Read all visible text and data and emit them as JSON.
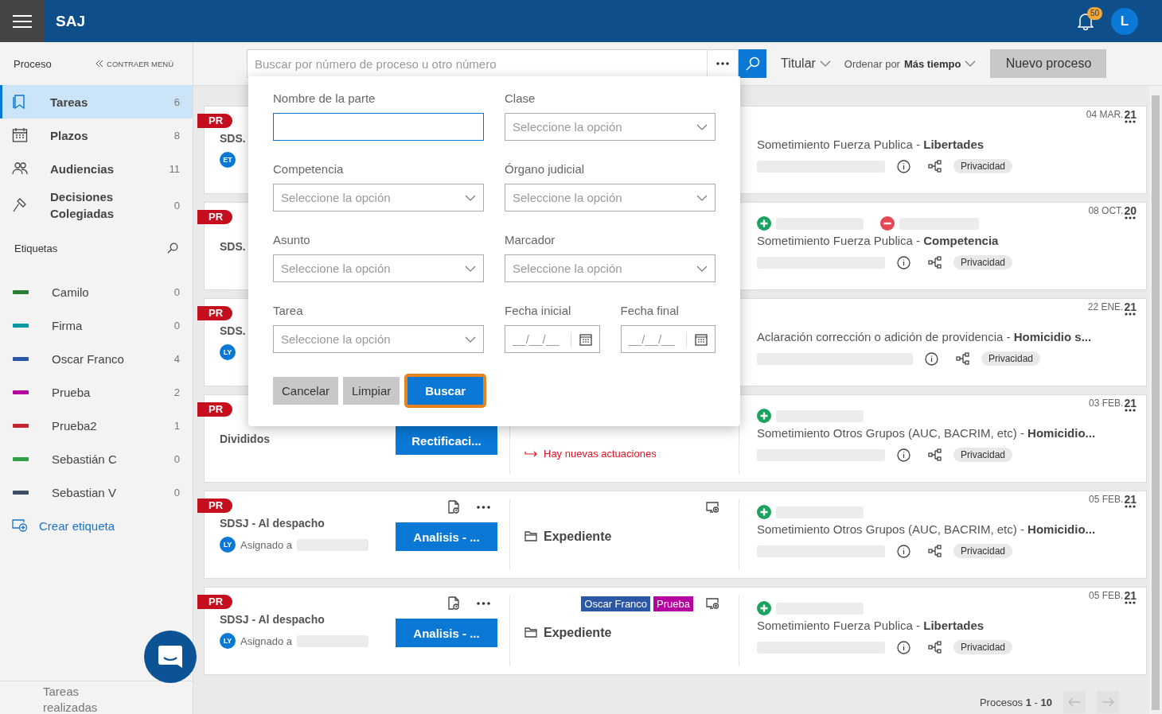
{
  "topbar": {
    "logo": "SAJ",
    "notifications": "50",
    "avatar": "L"
  },
  "sidebar": {
    "title": "Proceso",
    "collapse": "CONTRAER MENÚ",
    "nav": [
      {
        "label": "Tareas",
        "count": "6",
        "selected": true
      },
      {
        "label": "Plazos",
        "count": "8",
        "selected": false
      },
      {
        "label": "Audiencias",
        "count": "11",
        "selected": false
      },
      {
        "label": "Decisiones Colegiadas",
        "count": "0",
        "selected": false
      }
    ],
    "tags_title": "Etiquetas",
    "tags": [
      {
        "label": "Camilo",
        "count": "0",
        "color": "#2e7d32"
      },
      {
        "label": "Firma",
        "count": "0",
        "color": "#0097a7"
      },
      {
        "label": "Oscar Franco",
        "count": "4",
        "color": "#2b57a4"
      },
      {
        "label": "Prueba",
        "count": "2",
        "color": "#b4009e"
      },
      {
        "label": "Prueba2",
        "count": "1",
        "color": "#c4262e"
      },
      {
        "label": "Sebastián C",
        "count": "0",
        "color": "#2ea043"
      },
      {
        "label": "Sebastian V",
        "count": "0",
        "color": "#3b4f63"
      }
    ],
    "create_tag": "Crear etiqueta",
    "footer": "Tareas realizadas"
  },
  "toolbar": {
    "search_placeholder": "Buscar por número de proceso u otro número",
    "owner_filter": "Titular",
    "sort": "Ordenar por **Más tiempo**",
    "new_button": "Nuevo proceso"
  },
  "filter_panel": {
    "fields": [
      {
        "kind": "text",
        "label": "Nombre de la parte",
        "focused": true
      },
      {
        "kind": "select",
        "label": "Clase",
        "placeholder": "Seleccione la opción",
        "focused": false
      },
      {
        "kind": "select",
        "label": "Competencia",
        "placeholder": "Seleccione la opción",
        "focused": false
      },
      {
        "kind": "select",
        "label": "Órgano judicial",
        "placeholder": "Seleccione la opción",
        "focused": false
      },
      {
        "kind": "select",
        "label": "Asunto",
        "placeholder": "Seleccione la opción",
        "focused": false
      },
      {
        "kind": "select",
        "label": "Marcador",
        "placeholder": "Seleccione la opción",
        "focused": false
      },
      {
        "kind": "select",
        "label": "Tarea",
        "placeholder": "Seleccione la opción",
        "focused": false
      },
      {
        "kind": "date",
        "label": "Fecha inicial",
        "placeholder": "__/__/__",
        "focused": false
      },
      {
        "kind": "date",
        "label": "Fecha final",
        "placeholder": "__/__/__",
        "focused": false
      }
    ],
    "buttons": [
      {
        "label": "Cancelar",
        "kind": "secondary",
        "highlighted": false
      },
      {
        "label": "Limpiar",
        "kind": "secondary",
        "highlighted": false
      },
      {
        "label": "Buscar",
        "kind": "primary",
        "highlighted": true
      }
    ]
  },
  "cards": [
    {
      "badge": "PR",
      "title": "SDS.",
      "avatar": "ET",
      "date": "04 MAR.",
      "year": "21",
      "description": "Sometimiento Fuerza Publica - **Libertades**",
      "privacy": "Privacidad"
    },
    {
      "badge": "PR",
      "title": "SDS.",
      "date": "08 OCT.",
      "year": "20",
      "markers": [
        {
          "kind": "added"
        },
        {
          "kind": "removed"
        }
      ],
      "description": "Sometimiento Fuerza Publica - **Competencia**",
      "privacy": "Privacidad"
    },
    {
      "badge": "PR",
      "title": "SDS.",
      "avatar": "LY",
      "date": "22 ENE.",
      "year": "21",
      "description": "Aclaración corrección o adición de providencia - **Homicidio s...**",
      "privacy": "Privacidad"
    },
    {
      "badge": "PR",
      "title": "Divididos",
      "button": "Rectificaci...",
      "alert": "Hay nuevas actuaciones",
      "date": "03 FEB.",
      "year": "21",
      "markers": [
        {
          "kind": "added"
        }
      ],
      "description": "Sometimiento Otros Grupos (AUC, BACRIM, etc) - **Homicidio...**",
      "privacy": "Privacidad"
    },
    {
      "badge": "PR",
      "title": "SDSJ - Al despacho",
      "avatar": "LY",
      "assigned": "Asignado a",
      "button": "Analisis - ...",
      "actions": true,
      "media": true,
      "expediente": "Expediente",
      "date": "05 FEB.",
      "year": "21",
      "markers": [
        {
          "kind": "added"
        }
      ],
      "description": "Sometimiento Otros Grupos (AUC, BACRIM, etc) - **Homicidio...**",
      "privacy": "Privacidad"
    },
    {
      "badge": "PR",
      "title": "SDSJ - Al despacho",
      "avatar": "LY",
      "assigned": "Asignado a",
      "button": "Analisis - ...",
      "actions": true,
      "media": true,
      "tags": [
        {
          "label": "Oscar Franco",
          "color": "#2b57a4"
        },
        {
          "label": "Prueba",
          "color": "#b4009e"
        }
      ],
      "expediente": "Expediente",
      "date": "05 FEB.",
      "year": "21",
      "markers": [
        {
          "kind": "added"
        }
      ],
      "description": "Sometimiento Fuerza Publica - **Libertades**",
      "privacy": "Privacidad"
    }
  ],
  "pagination": {
    "label": "Procesos **1** - **10**"
  }
}
